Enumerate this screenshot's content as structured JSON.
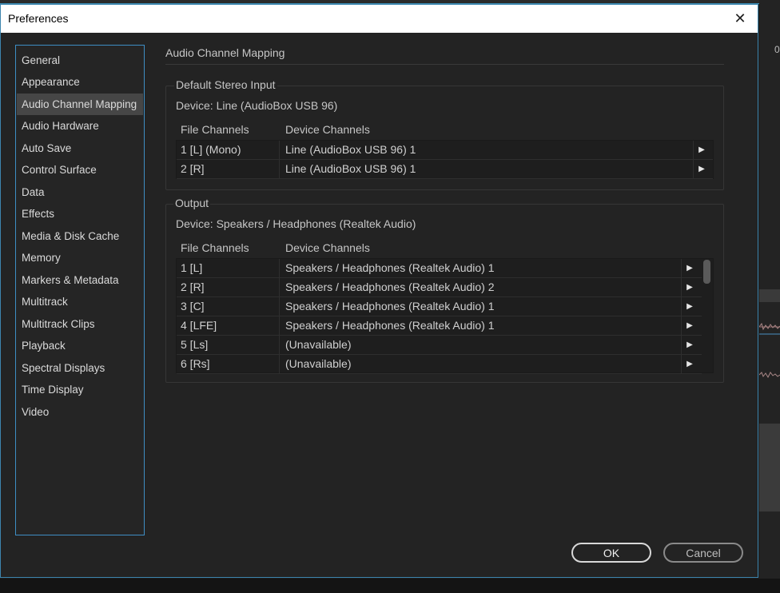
{
  "window": {
    "title": "Preferences",
    "close_glyph": "✕"
  },
  "background": {
    "digit": "0"
  },
  "nav": {
    "items": [
      {
        "label": "General",
        "selected": false
      },
      {
        "label": "Appearance",
        "selected": false
      },
      {
        "label": "Audio Channel Mapping",
        "selected": true
      },
      {
        "label": "Audio Hardware",
        "selected": false
      },
      {
        "label": "Auto Save",
        "selected": false
      },
      {
        "label": "Control Surface",
        "selected": false
      },
      {
        "label": "Data",
        "selected": false
      },
      {
        "label": "Effects",
        "selected": false
      },
      {
        "label": "Media & Disk Cache",
        "selected": false
      },
      {
        "label": "Memory",
        "selected": false
      },
      {
        "label": "Markers & Metadata",
        "selected": false
      },
      {
        "label": "Multitrack",
        "selected": false
      },
      {
        "label": "Multitrack Clips",
        "selected": false
      },
      {
        "label": "Playback",
        "selected": false
      },
      {
        "label": "Spectral Displays",
        "selected": false
      },
      {
        "label": "Time Display",
        "selected": false
      },
      {
        "label": "Video",
        "selected": false
      }
    ]
  },
  "panel": {
    "title": "Audio Channel Mapping",
    "input": {
      "legend": "Default Stereo Input",
      "device": "Device: Line (AudioBox USB 96)",
      "col_file": "File Channels",
      "col_device": "Device Channels",
      "rows": [
        {
          "file": "1 [L] (Mono)",
          "device": "Line (AudioBox USB 96) 1"
        },
        {
          "file": "2 [R]",
          "device": "Line (AudioBox USB 96) 1"
        }
      ]
    },
    "output": {
      "legend": "Output",
      "device": "Device: Speakers / Headphones (Realtek Audio)",
      "col_file": "File Channels",
      "col_device": "Device Channels",
      "rows": [
        {
          "file": "1 [L]",
          "device": "Speakers / Headphones (Realtek Audio) 1"
        },
        {
          "file": "2 [R]",
          "device": "Speakers / Headphones (Realtek Audio) 2"
        },
        {
          "file": "3 [C]",
          "device": "Speakers / Headphones (Realtek Audio) 1"
        },
        {
          "file": "4 [LFE]",
          "device": "Speakers / Headphones (Realtek Audio) 1"
        },
        {
          "file": "5 [Ls]",
          "device": "(Unavailable)"
        },
        {
          "file": "6 [Rs]",
          "device": "(Unavailable)"
        }
      ]
    }
  },
  "buttons": {
    "ok": "OK",
    "cancel": "Cancel"
  },
  "icons": {
    "row_arrow": "play-right-icon",
    "close": "close-icon"
  }
}
